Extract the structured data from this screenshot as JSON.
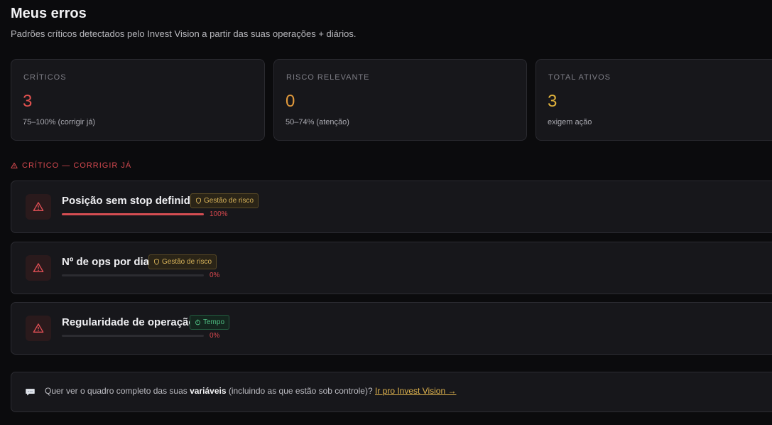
{
  "header": {
    "title": "Meus erros",
    "subtitle": "Padrões críticos detectados pelo Invest Vision a partir das suas operações + diários."
  },
  "stats": [
    {
      "label": "CRÍTICOS",
      "value": "3",
      "note": "75–100% (corrigir já)",
      "color": "#e0514f"
    },
    {
      "label": "RISCO RELEVANTE",
      "value": "0",
      "note": "50–74% (atenção)",
      "color": "#e29a3c"
    },
    {
      "label": "TOTAL ATIVOS",
      "value": "3",
      "note": "exigem ação",
      "color": "#e0b23c"
    }
  ],
  "section": {
    "icon": "warning-triangle-icon",
    "title": "CRÍTICO — CORRIGIR JÁ"
  },
  "errors": [
    {
      "name": "Posição sem stop definido",
      "tag": "Gestão de risco",
      "tag_icon": "shield-icon",
      "progress": 1.0,
      "pct": "100%"
    },
    {
      "name": "Nº de ops por dia",
      "tag": "Gestão de risco",
      "tag_icon": "shield-icon",
      "progress": 0.0,
      "pct": "0%"
    },
    {
      "name": "Regularidade de operação",
      "tag": "Tempo",
      "tag_icon": "clock-icon",
      "progress": 0.0,
      "pct": "0%"
    }
  ],
  "cta": {
    "icon": "speech-bubble-icon",
    "text_before": "Quer ver o quadro completo das suas ",
    "text_bold": "variáveis",
    "text_after": " (incluindo as que estão sob controle)? ",
    "link": "Ir pro Invest Vision →"
  },
  "colors": {
    "critical": "#d8484e",
    "accent": "#e0b44e"
  }
}
